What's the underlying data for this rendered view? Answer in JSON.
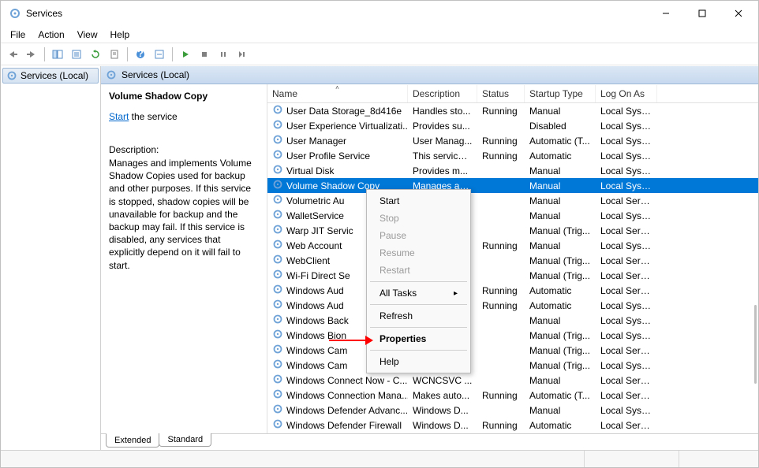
{
  "window": {
    "title": "Services"
  },
  "menubar": {
    "items": [
      "File",
      "Action",
      "View",
      "Help"
    ]
  },
  "toolbar_icons": [
    "back-icon",
    "forward-icon",
    "show-hide-tree-icon",
    "export-list-icon",
    "refresh-icon",
    "properties-icon",
    "help-icon",
    "new-icon",
    "start-icon",
    "play-icon",
    "stop-icon",
    "pause-icon",
    "restart-icon"
  ],
  "leftnav": {
    "root": "Services (Local)"
  },
  "content_header": "Services (Local)",
  "detail": {
    "title": "Volume Shadow Copy",
    "start_link": "Start",
    "start_suffix": " the service",
    "desc_label": "Description:",
    "description": "Manages and implements Volume Shadow Copies used for backup and other purposes. If this service is stopped, shadow copies will be unavailable for backup and the backup may fail. If this service is disabled, any services that explicitly depend on it will fail to start."
  },
  "columns": {
    "name": "Name",
    "desc": "Description",
    "status": "Status",
    "startup": "Startup Type",
    "logon": "Log On As"
  },
  "services": [
    {
      "name": "User Data Storage_8d416e",
      "desc": "Handles sto...",
      "status": "Running",
      "startup": "Manual",
      "logon": "Local Syste..."
    },
    {
      "name": "User Experience Virtualizati...",
      "desc": "Provides su...",
      "status": "",
      "startup": "Disabled",
      "logon": "Local Syste..."
    },
    {
      "name": "User Manager",
      "desc": "User Manag...",
      "status": "Running",
      "startup": "Automatic (T...",
      "logon": "Local Syste..."
    },
    {
      "name": "User Profile Service",
      "desc": "This service ...",
      "status": "Running",
      "startup": "Automatic",
      "logon": "Local Syste..."
    },
    {
      "name": "Virtual Disk",
      "desc": "Provides m...",
      "status": "",
      "startup": "Manual",
      "logon": "Local Syste..."
    },
    {
      "name": "Volume Shadow Copy",
      "desc": "Manages an...",
      "status": "",
      "startup": "Manual",
      "logon": "Local Syste...",
      "selected": true
    },
    {
      "name": "Volumetric Au",
      "desc": "...",
      "status": "",
      "startup": "Manual",
      "logon": "Local Service"
    },
    {
      "name": "WalletService",
      "desc": "...",
      "status": "",
      "startup": "Manual",
      "logon": "Local Syste..."
    },
    {
      "name": "Warp JIT Servic",
      "desc": "...",
      "status": "",
      "startup": "Manual (Trig...",
      "logon": "Local Service"
    },
    {
      "name": "Web Account",
      "desc": "...",
      "status": "Running",
      "startup": "Manual",
      "logon": "Local Syste..."
    },
    {
      "name": "WebClient",
      "desc": "...",
      "status": "",
      "startup": "Manual (Trig...",
      "logon": "Local Service"
    },
    {
      "name": "Wi-Fi Direct Se",
      "desc": "...",
      "status": "",
      "startup": "Manual (Trig...",
      "logon": "Local Service"
    },
    {
      "name": "Windows Aud",
      "desc": "...",
      "status": "Running",
      "startup": "Automatic",
      "logon": "Local Service"
    },
    {
      "name": "Windows Aud",
      "desc": "...",
      "status": "Running",
      "startup": "Automatic",
      "logon": "Local Syste..."
    },
    {
      "name": "Windows Back",
      "desc": "...",
      "status": "",
      "startup": "Manual",
      "logon": "Local Syste..."
    },
    {
      "name": "Windows Bion",
      "desc": "...",
      "status": "",
      "startup": "Manual (Trig...",
      "logon": "Local Syste..."
    },
    {
      "name": "Windows Cam",
      "desc": "...",
      "status": "",
      "startup": "Manual (Trig...",
      "logon": "Local Service"
    },
    {
      "name": "Windows Cam",
      "desc": "...",
      "status": "",
      "startup": "Manual (Trig...",
      "logon": "Local Syste..."
    },
    {
      "name": "Windows Connect Now - C...",
      "desc": "WCNCSVC ...",
      "status": "",
      "startup": "Manual",
      "logon": "Local Service"
    },
    {
      "name": "Windows Connection Mana...",
      "desc": "Makes auto...",
      "status": "Running",
      "startup": "Automatic (T...",
      "logon": "Local Service"
    },
    {
      "name": "Windows Defender Advanc...",
      "desc": "Windows D...",
      "status": "",
      "startup": "Manual",
      "logon": "Local Syste..."
    },
    {
      "name": "Windows Defender Firewall",
      "desc": "Windows D...",
      "status": "Running",
      "startup": "Automatic",
      "logon": "Local Service"
    }
  ],
  "context_menu": {
    "items": [
      {
        "label": "Start",
        "enabled": true
      },
      {
        "label": "Stop",
        "enabled": false
      },
      {
        "label": "Pause",
        "enabled": false
      },
      {
        "label": "Resume",
        "enabled": false
      },
      {
        "label": "Restart",
        "enabled": false
      },
      {
        "sep": true
      },
      {
        "label": "All Tasks",
        "enabled": true,
        "sub": true
      },
      {
        "sep": true
      },
      {
        "label": "Refresh",
        "enabled": true
      },
      {
        "sep": true
      },
      {
        "label": "Properties",
        "enabled": true,
        "bold": true
      },
      {
        "sep": true
      },
      {
        "label": "Help",
        "enabled": true
      }
    ]
  },
  "tabs": {
    "extended": "Extended",
    "standard": "Standard"
  }
}
